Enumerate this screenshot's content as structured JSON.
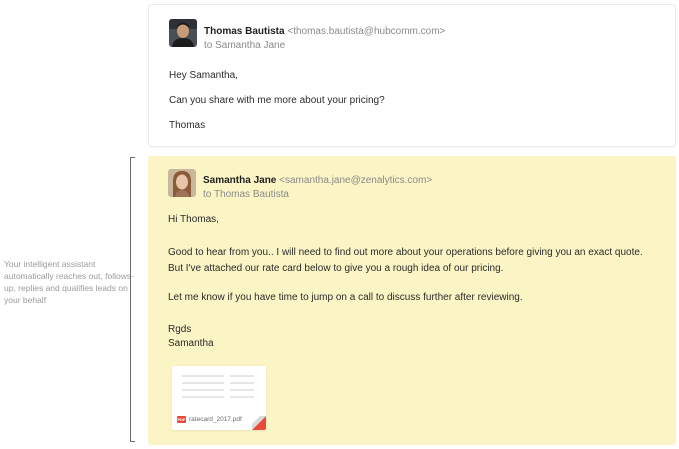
{
  "original_email": {
    "sender_name": "Thomas Bautista",
    "sender_email": "<thomas.bautista@hubcomm.com>",
    "recipient": "to Samantha Jane",
    "greeting": "Hey Samantha,",
    "body": "Can you share with me more about your pricing?",
    "signature": "Thomas"
  },
  "reply_email": {
    "sender_name": "Samantha Jane",
    "sender_email": "<samantha.jane@zenalytics.com>",
    "recipient": "to Thomas Bautista",
    "greeting": "Hi Thomas,",
    "body_line_1": "Good to hear from you.. I will need to find out more about your operations before giving you an exact quote.",
    "body_line_2": "But I've attached our rate card below to give you a rough idea of our pricing.",
    "body_line_3": "Let me know if you have time to jump on a call to discuss further after reviewing.",
    "closing": "Rgds",
    "signature": "Samantha",
    "attachment": {
      "file_type": "PDF",
      "file_name": "ratecard_2017.pdf"
    }
  },
  "side_note": "Your intelligent assistant automatically reaches out, follows-up, replies and qualifies leads on your behalf",
  "colors": {
    "reply_background": "#fbf4c5",
    "pdf_red": "#e8493a"
  }
}
